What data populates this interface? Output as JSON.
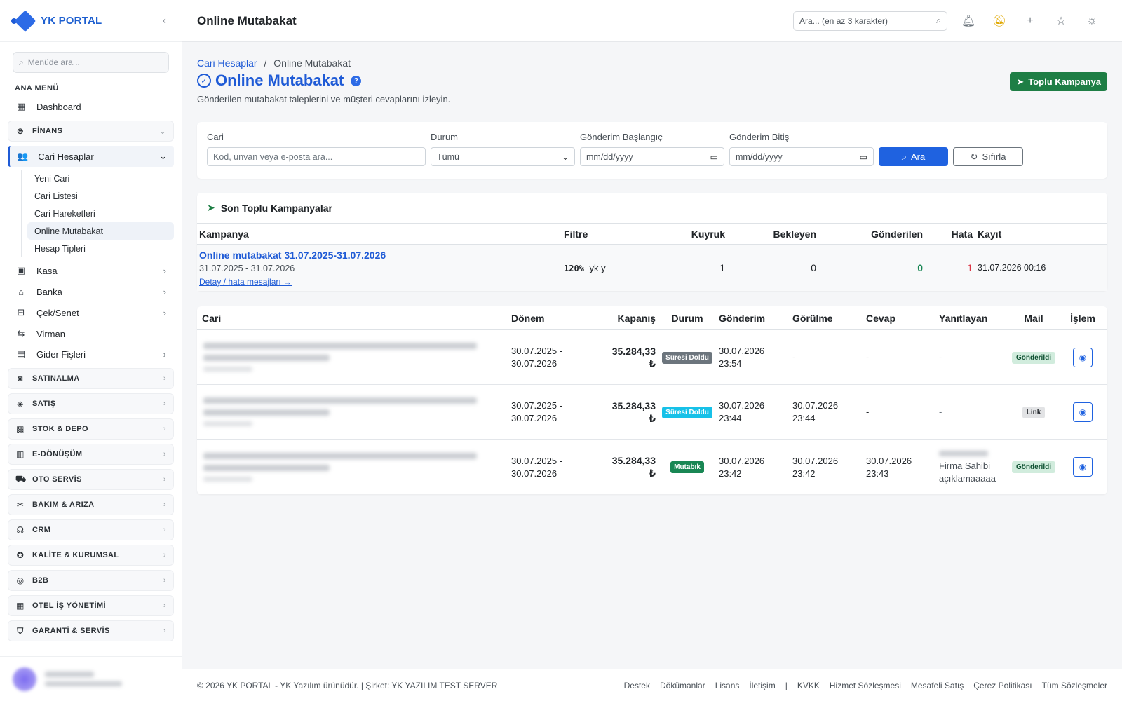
{
  "brand": {
    "name": "YK PORTAL",
    "collapse_icon": "chevron-left-icon"
  },
  "sidebar": {
    "search_placeholder": "Menüde ara...",
    "heading": "ANA MENÜ",
    "dashboard": "Dashboard",
    "finans": "FİNANS",
    "cari_hesaplar": "Cari Hesaplar",
    "cari_sub": [
      "Yeni Cari",
      "Cari Listesi",
      "Cari Hareketleri",
      "Online Mutabakat",
      "Hesap Tipleri"
    ],
    "finans_items": [
      "Kasa",
      "Banka",
      "Çek/Senet",
      "Virman",
      "Gider Fişleri"
    ],
    "groups": [
      "SATINALMA",
      "SATIŞ",
      "STOK & DEPO",
      "E-DÖNÜŞÜM",
      "OTO SERVİS",
      "BAKIM & ARIZA",
      "CRM",
      "KALİTE & KURUMSAL",
      "B2B",
      "OTEL İŞ YÖNETİMİ",
      "GARANTİ & SERVİS"
    ]
  },
  "topbar": {
    "title": "Online Mutabakat",
    "search_placeholder": "Ara... (en az 3 karakter)",
    "icons": [
      "bell-icon",
      "bell-warning-icon",
      "plus-icon",
      "star-icon",
      "sun-icon"
    ]
  },
  "page": {
    "breadcrumb_parent": "Cari Hesaplar",
    "breadcrumb_sep": "/",
    "breadcrumb_current": "Online Mutabakat",
    "title": "Online Mutabakat",
    "subtitle": "Gönderilen mutabakat taleplerini ve müşteri cevaplarını izleyin.",
    "campaign_button": "Toplu Kampanya"
  },
  "filters": {
    "cari_label": "Cari",
    "cari_placeholder": "Kod, unvan veya e-posta ara...",
    "durum_label": "Durum",
    "durum_value": "Tümü",
    "start_label": "Gönderim Başlangıç",
    "start_value": "mm/dd/yyyy",
    "end_label": "Gönderim Bitiş",
    "end_value": "mm/dd/yyyy",
    "search_button": "Ara",
    "reset_button": "Sıfırla"
  },
  "campaigns": {
    "title": "Son Toplu Kampanyalar",
    "columns": [
      "Kampanya",
      "Filtre",
      "Kuyruk",
      "Bekleyen",
      "Gönderilen",
      "Hata",
      "Kayıt"
    ],
    "rows": [
      {
        "name": "Online mutabakat 31.07.2025-31.07.2026",
        "dates": "31.07.2025 - 31.07.2026",
        "detail": "Detay / hata mesajları →",
        "filter_code": "120%",
        "filter_text": "yk y",
        "kuyruk": "1",
        "bekleyen": "0",
        "gonderilen": "0",
        "hata": "1",
        "kayit": "31.07.2026 00:16"
      }
    ]
  },
  "records": {
    "columns": [
      "Cari",
      "Dönem",
      "Kapanış",
      "Durum",
      "Gönderim",
      "Görülme",
      "Cevap",
      "Yanıtlayan",
      "Mail",
      "İşlem"
    ],
    "rows": [
      {
        "donem1": "30.07.2025 -",
        "donem2": "30.07.2026",
        "kapanis": "35.284,33",
        "currency": "₺",
        "durum": "Süresi Doldu",
        "gonderim1": "30.07.2026",
        "gonderim2": "23:54",
        "gorulme1": "-",
        "gorulme2": "",
        "cevap1": "-",
        "cevap2": "",
        "yanitlayan1": "-",
        "yanitlayan2": "",
        "mail": "Gönderildi"
      },
      {
        "donem1": "30.07.2025 -",
        "donem2": "30.07.2026",
        "kapanis": "35.284,33",
        "currency": "₺",
        "durum": "Süresi Doldu",
        "gonderim1": "30.07.2026",
        "gonderim2": "23:44",
        "gorulme1": "30.07.2026",
        "gorulme2": "23:44",
        "cevap1": "-",
        "cevap2": "",
        "yanitlayan1": "-",
        "yanitlayan2": "",
        "mail": "Link"
      },
      {
        "donem1": "30.07.2025 -",
        "donem2": "30.07.2026",
        "kapanis": "35.284,33",
        "currency": "₺",
        "durum": "Mutabık",
        "gonderim1": "30.07.2026",
        "gonderim2": "23:42",
        "gorulme1": "30.07.2026",
        "gorulme2": "23:42",
        "cevap1": "30.07.2026",
        "cevap2": "23:43",
        "yanitlayan1": "Firma Sahibi",
        "yanitlayan2": "açıklamaaaaa",
        "mail": "Gönderildi"
      }
    ]
  },
  "footer": {
    "copyright": "© 2026 YK PORTAL - YK Yazılım ürünüdür. | Şirket: YK YAZILIM TEST SERVER",
    "links": [
      "Destek",
      "Dökümanlar",
      "Lisans",
      "İletişim",
      "|",
      "KVKK",
      "Hizmet Sözleşmesi",
      "Mesafeli Satış",
      "Çerez Politikası",
      "Tüm Sözleşmeler"
    ]
  },
  "colors": {
    "primary": "#1f5bd6",
    "success": "#1e7e45",
    "danger": "#dc3545",
    "info": "#17c1e8"
  }
}
